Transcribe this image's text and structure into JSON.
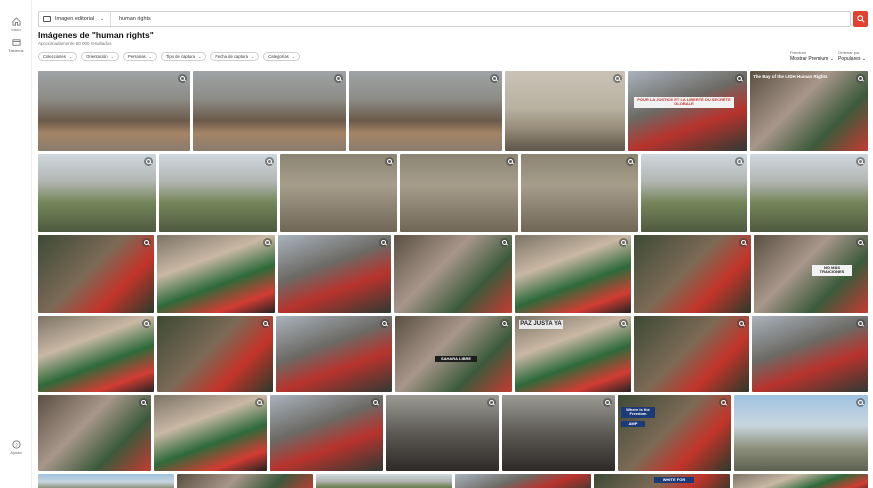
{
  "rail": {
    "home_label": "Inicio",
    "boards_label": "Tableros",
    "help_label": "Ayuda"
  },
  "search": {
    "filter_label": "Imagen editorial",
    "query": "human rights"
  },
  "page": {
    "title": "Imágenes de \"human rights\"",
    "result_count": "Aproximadamente 60.000 resultados"
  },
  "filters": [
    {
      "label": "Colecciones"
    },
    {
      "label": "Orientación"
    },
    {
      "label": "Personas"
    },
    {
      "label": "Tipo de captura"
    },
    {
      "label": "Fecha de captura"
    },
    {
      "label": "Categorías"
    }
  ],
  "sort": {
    "premium_label": "Premium",
    "premium_value": "Mostrar Premium",
    "order_label": "Ordenar por",
    "order_value": "Populares"
  },
  "images": {
    "tile_6_caption": "The Bay of the LIDH Human Rights",
    "sign_1": "POUR LA JUSTICE ET LA LIBERTÉ DU SECRÉTE GLOBALE",
    "sign_2": "PAZ JUSTA YA",
    "sign_3": "NO MÁS TRAICIONES",
    "sign_4": "SAHARA LIBRE",
    "sign_5": "Where is the Freedom",
    "sign_6": "AMP",
    "sign_7": "WHITE FOR"
  },
  "colors": {
    "accent": "#e2412f",
    "border": "#cfcfcf"
  }
}
